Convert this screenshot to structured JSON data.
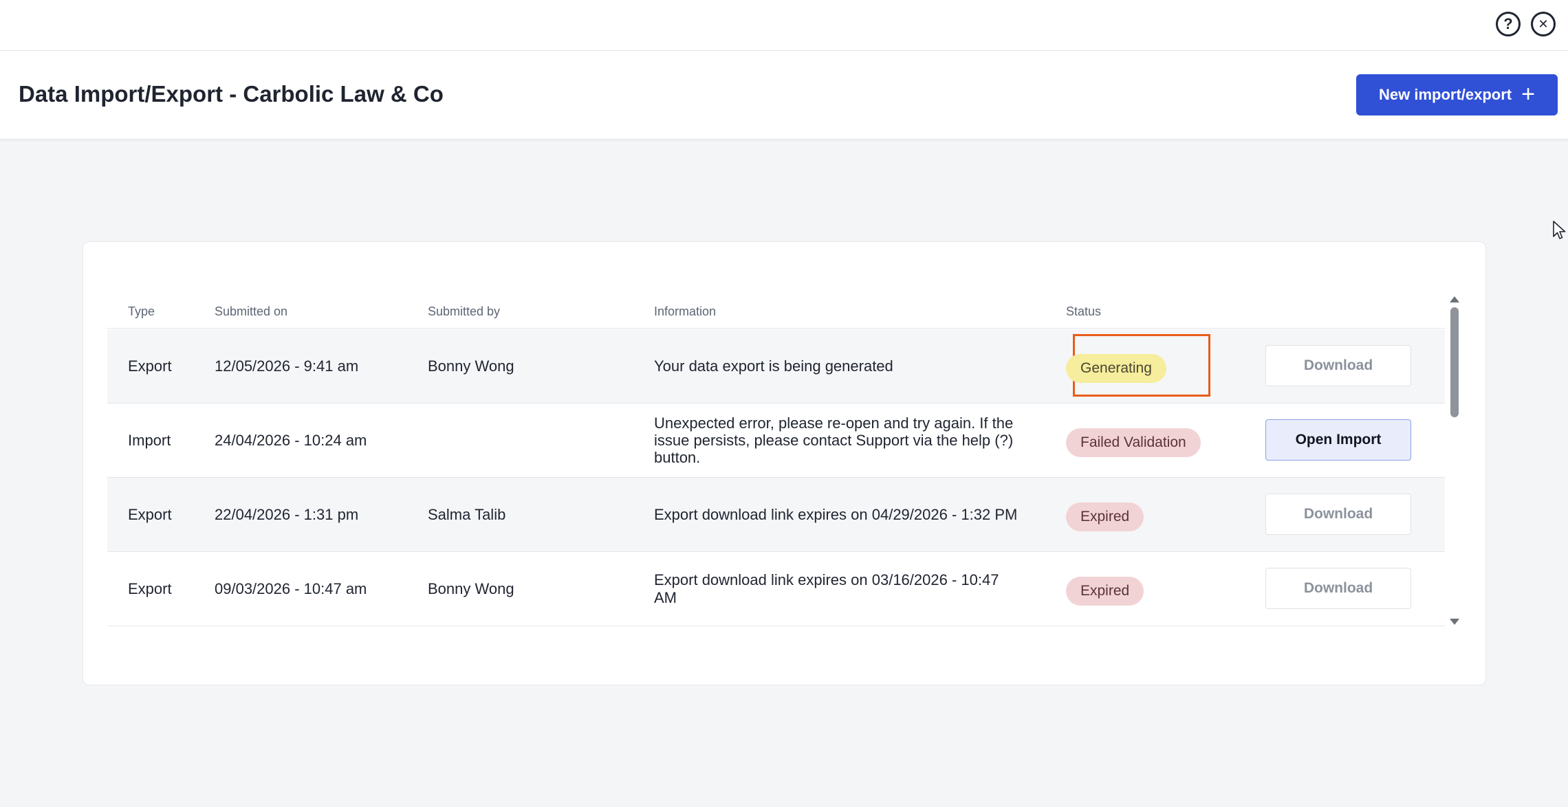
{
  "topbar": {
    "help_icon": "?",
    "close_icon": "✕"
  },
  "header": {
    "title": "Data Import/Export - Carbolic Law & Co",
    "new_button_label": "New import/export",
    "new_button_icon": "+"
  },
  "table": {
    "columns": {
      "type": "Type",
      "submitted_on": "Submitted on",
      "submitted_by": "Submitted by",
      "information": "Information",
      "status": "Status"
    },
    "rows": [
      {
        "type": "Export",
        "submitted_on": "12/05/2026 - 9:41 am",
        "submitted_by": "Bonny Wong",
        "information": "Your data export is being generated",
        "status": "Generating",
        "action": "Download"
      },
      {
        "type": "Import",
        "submitted_on": "24/04/2026 - 10:24 am",
        "submitted_by": "",
        "information": "Unexpected error, please re-open and try again. If the issue persists, please contact Support via the help (?) button.",
        "status": "Failed Validation",
        "action": "Open Import"
      },
      {
        "type": "Export",
        "submitted_on": "22/04/2026 - 1:31 pm",
        "submitted_by": "Salma Talib",
        "information": "Export download link expires on 04/29/2026 - 1:32 PM",
        "status": "Expired",
        "action": "Download"
      },
      {
        "type": "Export",
        "submitted_on": "09/03/2026 - 10:47 am",
        "submitted_by": "Bonny Wong",
        "information": "Export download link expires on 03/16/2026 - 10:47 AM",
        "status": "Expired",
        "action": "Download"
      }
    ]
  },
  "colors": {
    "primary": "#3050d6",
    "generating_badge": "#f6ed9d",
    "failed_badge": "#f2d3d5",
    "highlight_outline": "#e85d1a"
  }
}
